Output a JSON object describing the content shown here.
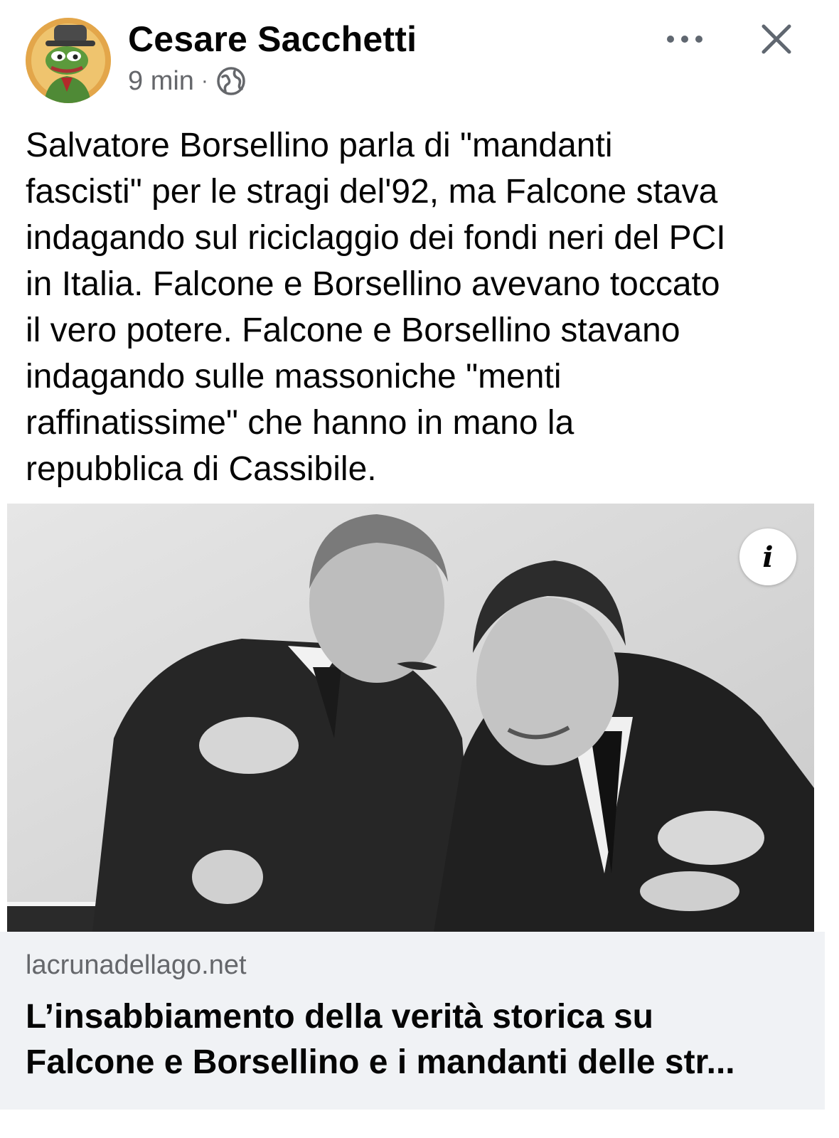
{
  "post": {
    "author_name": "Cesare Sacchetti",
    "timestamp": "9 min",
    "separator": "·",
    "audience_icon": "globe-icon",
    "avatar_icon": "frog-avatar-icon",
    "more_icon": "more-horizontal-icon",
    "close_icon": "close-icon",
    "text_lines": [
      "Salvatore Borsellino parla di \"mandanti",
      "fascisti\" per le stragi del'92, ma Falcone stava",
      "indagando sul riciclaggio dei fondi neri del PCI",
      "in Italia. Falcone e Borsellino avevano toccato",
      "il vero potere. Falcone e Borsellino stavano",
      "indagando sulle massoniche \"menti",
      "raffinatissime\" che hanno in mano la",
      "repubblica di Cassibile."
    ]
  },
  "link_preview": {
    "image_icon": "photo",
    "info_label": "i",
    "domain": "lacrunadellago.net",
    "title_lines": [
      "L’insabbiamento della verità storica su",
      "Falcone e Borsellino e i mandanti delle str..."
    ]
  },
  "colors": {
    "text_primary": "#050505",
    "text_secondary": "#65676b",
    "caption_background": "#f0f2f5"
  }
}
